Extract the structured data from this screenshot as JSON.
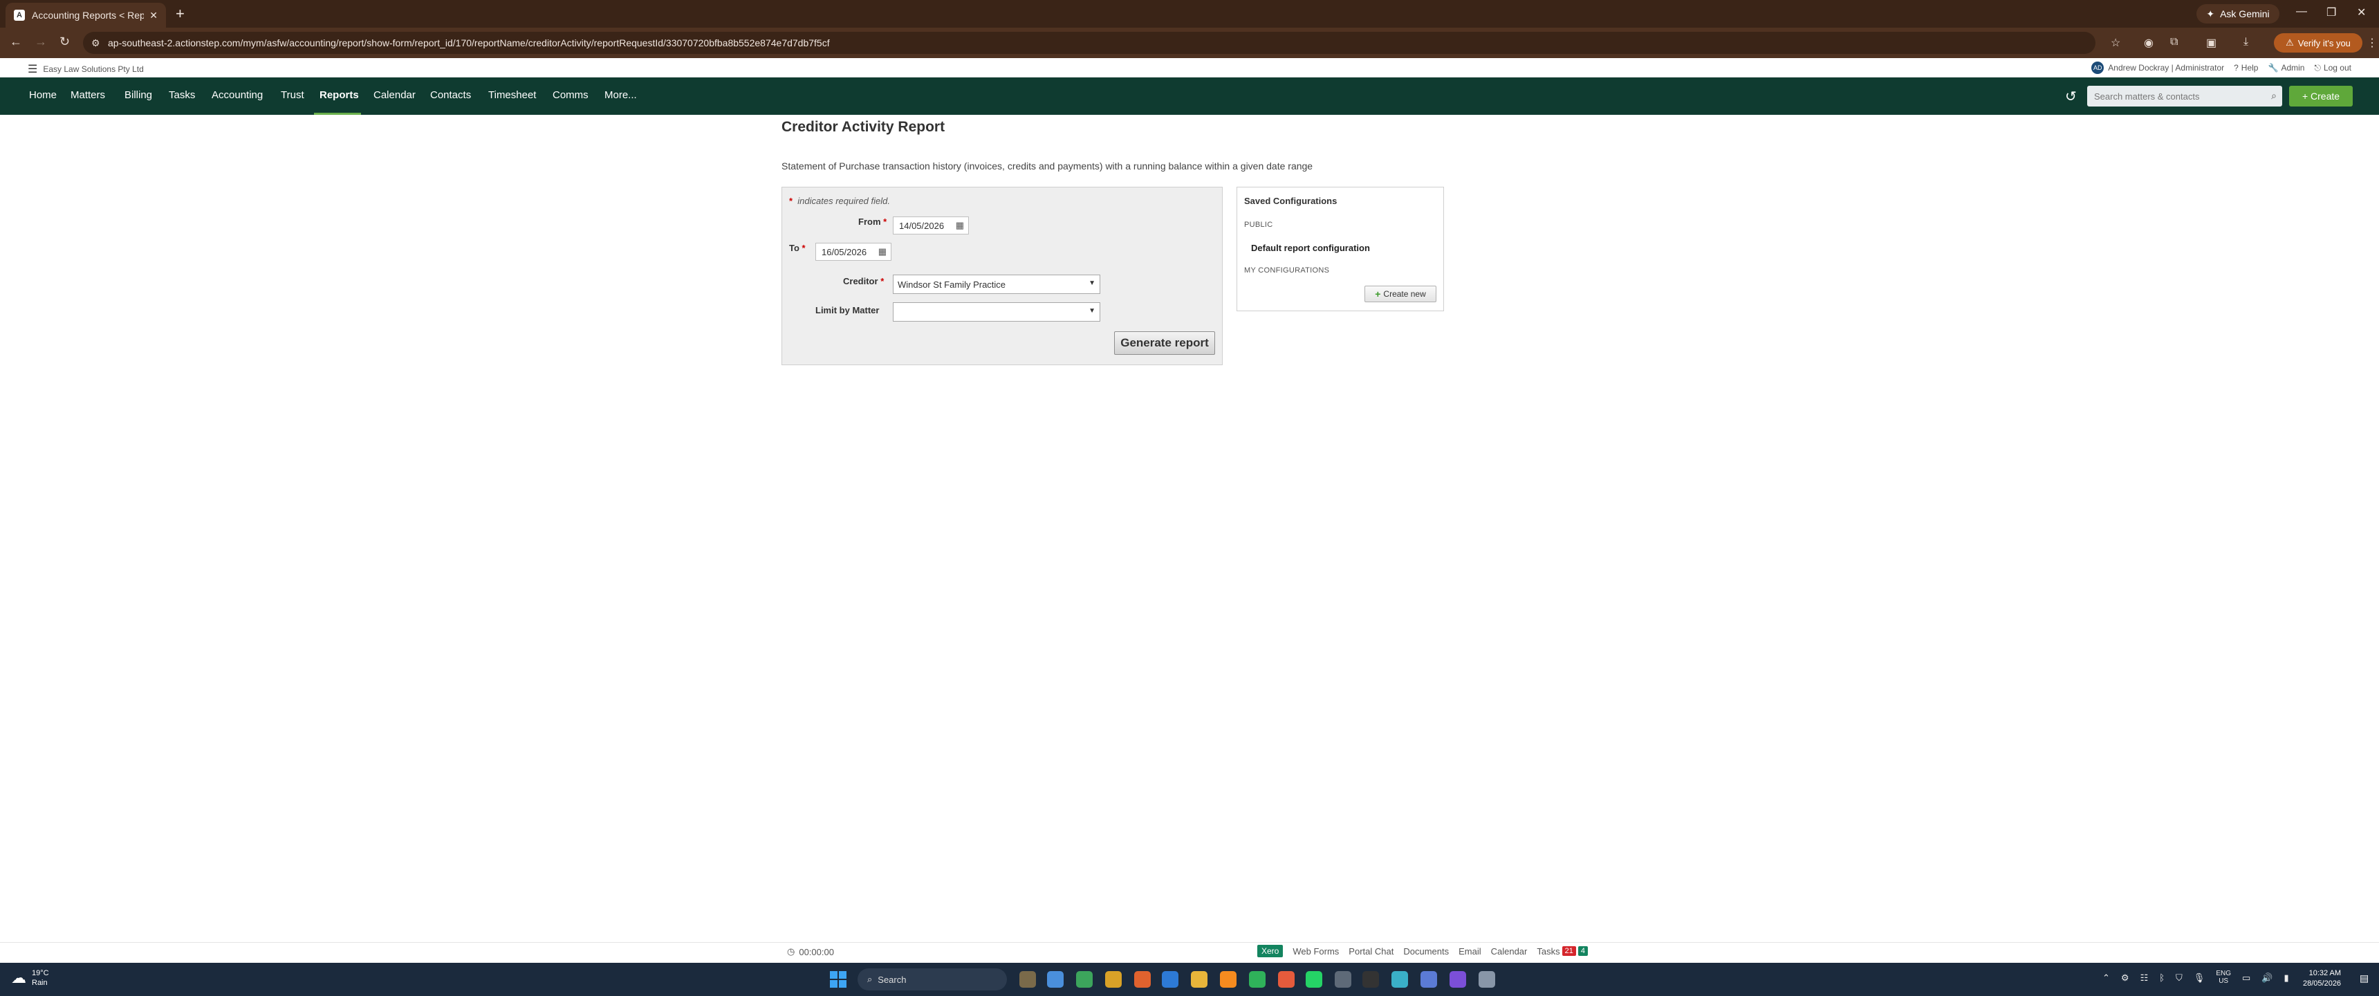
{
  "browser": {
    "tab_title": "Accounting Reports < Reports",
    "tab_favicon": "A",
    "url": "ap-southeast-2.actionstep.com/mym/asfw/accounting/report/show-form/report_id/170/reportName/creditorActivity/reportRequestId/33070720bfba8b552e874e7d7db7f5cf",
    "ask_gemini": "Ask Gemini",
    "verify": "Verify it's you"
  },
  "header": {
    "firm_name": "Easy Law Solutions Pty Ltd",
    "user_initials": "AD",
    "user": "Andrew Dockray | Administrator",
    "help": "Help",
    "admin": "Admin",
    "logout": "Log out"
  },
  "nav": {
    "items": [
      "Home",
      "Matters",
      "Billing",
      "Tasks",
      "Accounting",
      "Trust",
      "Reports",
      "Calendar",
      "Contacts",
      "Timesheet",
      "Comms",
      "More..."
    ],
    "active": "Reports",
    "search_placeholder": "Search matters & contacts",
    "create_label": "+ Create"
  },
  "page": {
    "title": "Creditor Activity Report",
    "description": "Statement of Purchase transaction history (invoices, credits and payments) with a running balance within a given date range"
  },
  "form": {
    "required_note": "indicates required field.",
    "from_label": "From",
    "from_value": "14/05/2026",
    "to_label": "To",
    "to_value": "16/05/2026",
    "creditor_label": "Creditor",
    "creditor_value": "Windsor St Family Practice",
    "limit_label": "Limit by Matter",
    "limit_value": "",
    "generate_label": "Generate report"
  },
  "saved": {
    "title": "Saved Configurations",
    "public_label": "PUBLIC",
    "default_item": "Default report configuration",
    "my_label": "MY CONFIGURATIONS",
    "create_new": "Create new"
  },
  "bottombar": {
    "timer": "00:00:00",
    "xero": "Xero",
    "links": [
      "Web Forms",
      "Portal Chat",
      "Documents",
      "Email",
      "Calendar"
    ],
    "tasks_label": "Tasks",
    "tasks_overdue": "21",
    "tasks_today": "4"
  },
  "taskbar": {
    "temp": "19°C",
    "weather": "Rain",
    "search": "Search",
    "lang": "ENG",
    "region": "US",
    "time": "10:32 AM",
    "date": "28/05/2026"
  },
  "colors": {
    "nav_bg": "#0f3b30",
    "accent_green": "#5fa83a",
    "chrome_bg": "#3a2417"
  }
}
